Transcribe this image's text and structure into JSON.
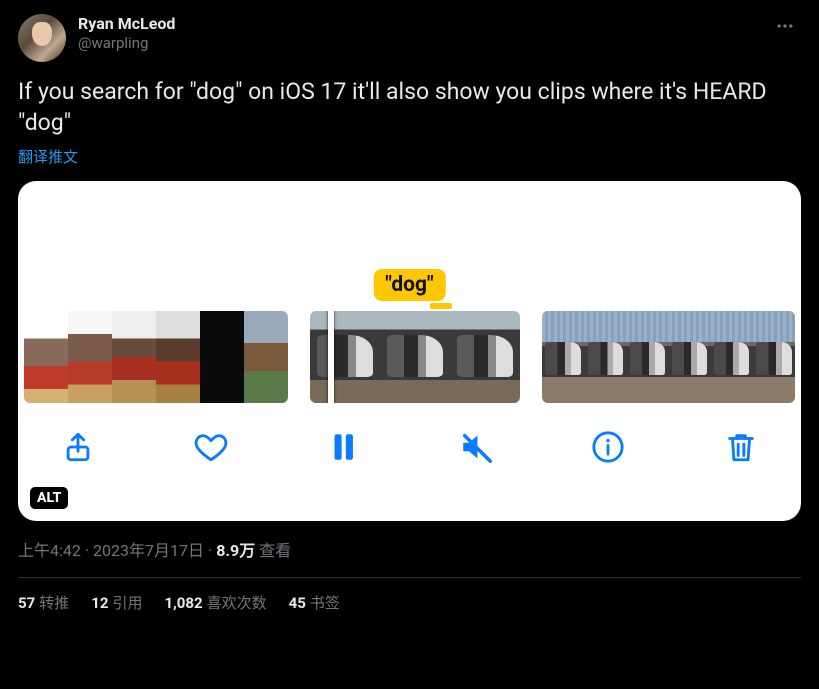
{
  "author": {
    "display_name": "Ryan McLeod",
    "handle": "@warpling"
  },
  "body": "If you search for \"dog\" on iOS 17 it'll also show you clips where it's HEARD \"dog\"",
  "translate_label": "翻译推文",
  "media": {
    "tag_text": "\"dog\"",
    "alt_badge": "ALT",
    "toolbar": {
      "share": "share-icon",
      "heart": "heart-icon",
      "pause": "pause-icon",
      "mute": "mute-icon",
      "info": "info-icon",
      "trash": "trash-icon"
    }
  },
  "meta": {
    "time": "上午4:42",
    "date": "2023年7月17日",
    "views_count": "8.9万",
    "views_label": "查看"
  },
  "stats": {
    "retweets": {
      "count": "57",
      "label": "转推"
    },
    "quotes": {
      "count": "12",
      "label": "引用"
    },
    "likes": {
      "count": "1,082",
      "label": "喜欢次数"
    },
    "bookmarks": {
      "count": "45",
      "label": "书签"
    }
  }
}
